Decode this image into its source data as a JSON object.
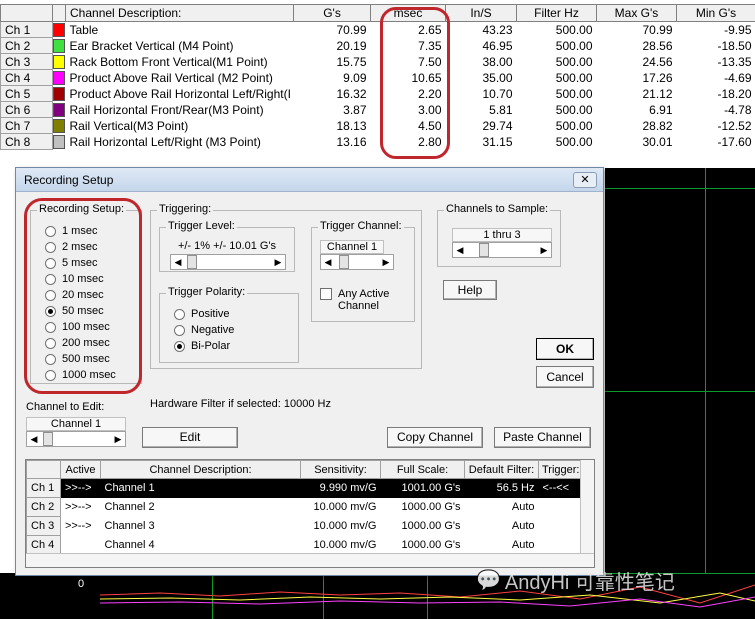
{
  "channel_table": {
    "headers": [
      "Channel Description:",
      "G's",
      "msec",
      "In/S",
      "Filter Hz",
      "Max G's",
      "Min G's"
    ],
    "rows": [
      {
        "ch": "Ch 1",
        "color": "#ff0000",
        "desc": "Table",
        "g": "70.99",
        "msec": "2.65",
        "ins": "43.23",
        "filter": "500.00",
        "max": "70.99",
        "min": "-9.95"
      },
      {
        "ch": "Ch 2",
        "color": "#40e040",
        "desc": "Ear Bracket  Vertical (M4 Point)",
        "g": "20.19",
        "msec": "7.35",
        "ins": "46.95",
        "filter": "500.00",
        "max": "28.56",
        "min": "-18.50"
      },
      {
        "ch": "Ch 3",
        "color": "#ffff00",
        "desc": "Rack Bottom Front Vertical(M1 Point)",
        "g": "15.75",
        "msec": "7.50",
        "ins": "38.00",
        "filter": "500.00",
        "max": "24.56",
        "min": "-13.35"
      },
      {
        "ch": "Ch 4",
        "color": "#ff00ff",
        "desc": "Product Above Rail Vertical (M2 Point)",
        "g": "9.09",
        "msec": "10.65",
        "ins": "35.00",
        "filter": "500.00",
        "max": "17.26",
        "min": "-4.69"
      },
      {
        "ch": "Ch 5",
        "color": "#a00000",
        "desc": "Product Above Rail Horizontal Left/Right(I",
        "g": "16.32",
        "msec": "2.20",
        "ins": "10.70",
        "filter": "500.00",
        "max": "21.12",
        "min": "-18.20"
      },
      {
        "ch": "Ch 6",
        "color": "#800080",
        "desc": "Rail Horizontal Front/Rear(M3 Point)",
        "g": "3.87",
        "msec": "3.00",
        "ins": "5.81",
        "filter": "500.00",
        "max": "6.91",
        "min": "-4.78"
      },
      {
        "ch": "Ch 7",
        "color": "#808000",
        "desc": "Rail Vertical(M3 Point)",
        "g": "18.13",
        "msec": "4.50",
        "ins": "29.74",
        "filter": "500.00",
        "max": "28.82",
        "min": "-12.52"
      },
      {
        "ch": "Ch 8",
        "color": "#c0c0c0",
        "desc": "Rail Horizontal Left/Right (M3 Point)",
        "g": "13.16",
        "msec": "2.80",
        "ins": "31.15",
        "filter": "500.00",
        "max": "30.01",
        "min": "-17.60"
      }
    ]
  },
  "dialog": {
    "title": "Recording Setup",
    "close_icon": "close-icon",
    "recording_setup": {
      "label": "Recording Setup:",
      "options": [
        "1 msec",
        "2 msec",
        "5 msec",
        "10 msec",
        "20 msec",
        "50 msec",
        "100 msec",
        "200 msec",
        "500 msec",
        "1000 msec"
      ],
      "selected": "50 msec"
    },
    "triggering": {
      "label": "Triggering:",
      "trigger_level": {
        "label": "Trigger Level:",
        "value": "+/-  1%   +/- 10.01 G's"
      },
      "trigger_channel": {
        "label": "Trigger Channel:",
        "value": "Channel 1"
      },
      "any_active_channel": "Any Active Channel",
      "any_active_checked": false,
      "polarity": {
        "label": "Trigger Polarity:",
        "options": [
          "Positive",
          "Negative",
          "Bi-Polar"
        ],
        "selected": "Bi-Polar"
      }
    },
    "channels_to_sample": {
      "label": "Channels to Sample:",
      "value": "1 thru 3"
    },
    "help_label": "Help",
    "ok_label": "OK",
    "cancel_label": "Cancel",
    "hardware_filter": "Hardware Filter if selected: 10000 Hz",
    "channel_to_edit": {
      "label": "Channel to Edit:",
      "value": "Channel 1"
    },
    "edit_label": "Edit",
    "copy_channel_label": "Copy Channel",
    "paste_channel_label": "Paste Channel",
    "grid": {
      "headers": [
        "Active",
        "Channel Description:",
        "Sensitivity:",
        "Full Scale:",
        "Default Filter:",
        "Trigger:"
      ],
      "rows": [
        {
          "ch": "Ch 1",
          "active": ">>-->",
          "desc": "Channel 1",
          "sens": "9.990 mv/G",
          "scale": "1001.00 G's",
          "filter": "56.5 Hz",
          "trigger": "<--<<"
        },
        {
          "ch": "Ch 2",
          "active": ">>-->",
          "desc": "Channel 2",
          "sens": "10.000 mv/G",
          "scale": "1000.00 G's",
          "filter": "Auto",
          "trigger": ""
        },
        {
          "ch": "Ch 3",
          "active": ">>-->",
          "desc": "Channel 3",
          "sens": "10.000 mv/G",
          "scale": "1000.00 G's",
          "filter": "Auto",
          "trigger": ""
        },
        {
          "ch": "Ch 4",
          "active": "",
          "desc": "Channel 4",
          "sens": "10.000 mv/G",
          "scale": "1000.00 G's",
          "filter": "Auto",
          "trigger": ""
        }
      ]
    }
  },
  "chart": {
    "zero_label": "0"
  },
  "watermark": "AndyHi 可靠性笔记",
  "colors": {
    "highlight_oval": "#c0272d",
    "grid_line": "#0b9b2a",
    "selected_row": "#000000"
  }
}
